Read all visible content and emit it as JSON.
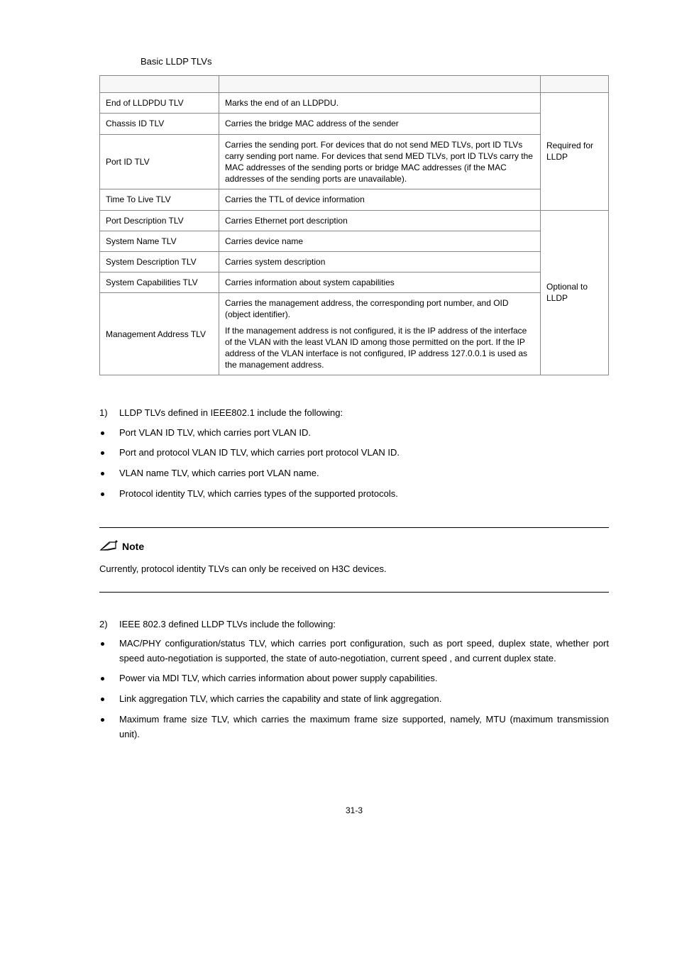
{
  "table": {
    "caption": "Basic LLDP TLVs",
    "remark_required": "Required for LLDP",
    "remark_optional": "Optional to LLDP",
    "rows": {
      "end": {
        "type": "End of LLDPDU TLV",
        "desc": "Marks the end of an LLDPDU."
      },
      "chassis": {
        "type": "Chassis ID TLV",
        "desc": "Carries the bridge MAC address of the sender"
      },
      "port": {
        "type": "Port ID TLV",
        "desc": "Carries the sending port. For devices that do not send MED TLVs, port ID TLVs carry sending port name. For devices that send MED TLVs, port ID TLVs carry the MAC addresses of the sending ports or bridge MAC addresses (if the MAC addresses of the sending ports are unavailable)."
      },
      "ttl": {
        "type": "Time To Live TLV",
        "desc": "Carries the TTL of device information"
      },
      "pdesc": {
        "type": "Port Description TLV",
        "desc": "Carries Ethernet port description"
      },
      "sysname": {
        "type": "System Name TLV",
        "desc": "Carries device name"
      },
      "sysdesc": {
        "type": "System Description TLV",
        "desc": "Carries system description"
      },
      "syscap": {
        "type": "System Capabilities TLV",
        "desc": "Carries information about system capabilities"
      },
      "mgmt": {
        "type": "Management Address TLV",
        "desc_p1": "Carries the management address, the corresponding port number, and OID (object identifier).",
        "desc_p2": "If the management address is not configured, it is the IP address of the interface of the VLAN with the least VLAN ID among those permitted on the port. If the IP address of the VLAN interface is not configured, IP address 127.0.0.1 is used as the management address."
      }
    }
  },
  "section1": {
    "num": "1)",
    "intro": "LLDP TLVs defined in IEEE802.1 include the following:",
    "b1": "Port VLAN ID TLV, which carries port VLAN ID.",
    "b2": "Port and protocol VLAN ID TLV, which carries port protocol VLAN ID.",
    "b3": "VLAN name TLV, which carries port VLAN name.",
    "b4": "Protocol identity TLV, which carries types of the supported protocols."
  },
  "note": {
    "label": "Note",
    "text": "Currently, protocol identity TLVs can only be received on H3C devices."
  },
  "section2": {
    "num": "2)",
    "intro": "IEEE 802.3 defined LLDP TLVs include the following:",
    "b1": "MAC/PHY configuration/status TLV, which carries port configuration, such as port speed, duplex state, whether port speed auto-negotiation is supported, the state of auto-negotiation, current speed , and current duplex state.",
    "b2": "Power via MDI TLV, which carries information about power supply capabilities.",
    "b3": "Link aggregation TLV, which carries the capability and state of link aggregation.",
    "b4": "Maximum frame size TLV, which carries the maximum frame size supported, namely, MTU (maximum transmission unit)."
  },
  "page_number": "31-3"
}
